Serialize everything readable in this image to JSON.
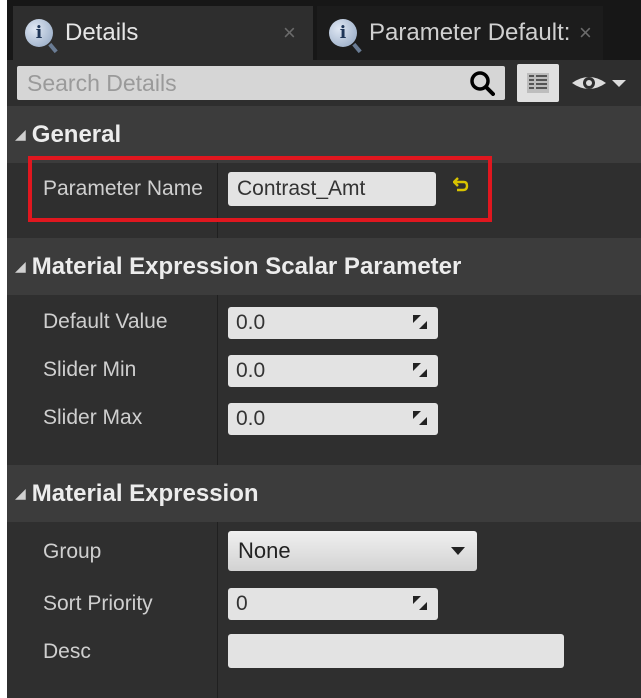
{
  "tabs": [
    {
      "label": "Details",
      "active": true
    },
    {
      "label": "Parameter Default:",
      "active": false
    }
  ],
  "search": {
    "placeholder": "Search Details"
  },
  "sections": {
    "general": {
      "title": "General",
      "parameter_name_label": "Parameter Name",
      "parameter_name_value": "Contrast_Amt"
    },
    "scalar": {
      "title": "Material Expression Scalar Parameter",
      "props": [
        {
          "label": "Default Value",
          "value": "0.0"
        },
        {
          "label": "Slider Min",
          "value": "0.0"
        },
        {
          "label": "Slider Max",
          "value": "0.0"
        }
      ]
    },
    "expression": {
      "title": "Material Expression",
      "group_label": "Group",
      "group_value": "None",
      "sort_label": "Sort Priority",
      "sort_value": "0",
      "desc_label": "Desc",
      "desc_value": ""
    }
  },
  "colors": {
    "highlight": "#e0171f",
    "reset_arrow": "#d8c300"
  }
}
